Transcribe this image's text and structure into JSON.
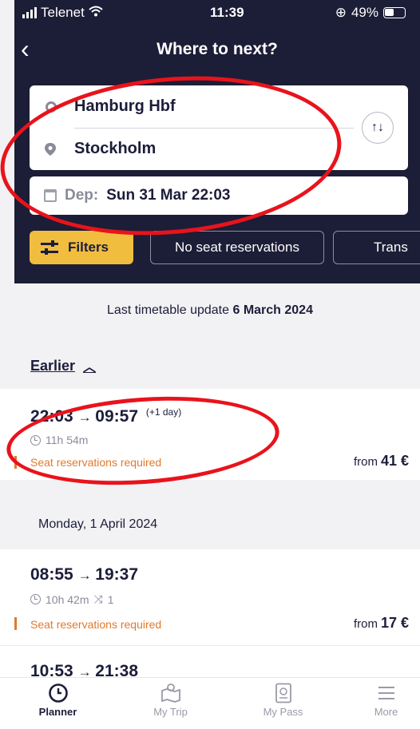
{
  "status_bar": {
    "carrier": "Telenet",
    "time": "11:39",
    "battery": "49%"
  },
  "nav": {
    "title": "Where to next?"
  },
  "route": {
    "from": "Hamburg Hbf",
    "to": "Stockholm"
  },
  "departure": {
    "prefix": "Dep:",
    "value": "Sun 31 Mar 22:03"
  },
  "chips": {
    "filters": "Filters",
    "no_seat": "No seat reservations",
    "transfers": "Trans"
  },
  "update": {
    "prefix": "Last timetable update",
    "date": "6 March 2024"
  },
  "earlier": {
    "label": "Earlier"
  },
  "journeys": [
    {
      "dep": "22:03",
      "arr": "09:57",
      "note": "(+1 day)",
      "duration": "11h 54m",
      "changes": "",
      "seat": "Seat reservations required",
      "price_prefix": "from",
      "price": "41 €"
    },
    {
      "dep": "08:55",
      "arr": "19:37",
      "note": "",
      "duration": "10h 42m",
      "changes": "1",
      "seat": "Seat reservations required",
      "price_prefix": "from",
      "price": "17 €"
    },
    {
      "dep": "10:53",
      "arr": "21:38"
    }
  ],
  "day_header": "Monday, 1 April 2024",
  "tabs": [
    {
      "label": "Planner",
      "icon": "clock-icon"
    },
    {
      "label": "My Trip",
      "icon": "map-icon"
    },
    {
      "label": "My Pass",
      "icon": "pass-icon"
    },
    {
      "label": "More",
      "icon": "menu-icon"
    }
  ],
  "colors": {
    "header_bg": "#1c1d36",
    "accent": "#f1bd3f",
    "warning": "#e07a2e",
    "annotation": "#e8131c"
  }
}
